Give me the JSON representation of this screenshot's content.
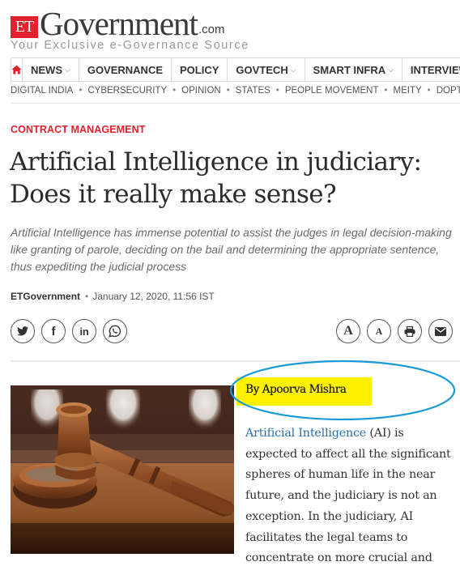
{
  "site": {
    "logo_badge": "ET",
    "logo_name": "Government",
    "logo_suffix": ".com",
    "tagline": "Your Exclusive e-Governance Source",
    "brand_color": "#e4202e"
  },
  "nav": {
    "home_icon": "home-icon",
    "items": [
      {
        "label": "NEWS",
        "has_dropdown": true
      },
      {
        "label": "GOVERNANCE",
        "has_dropdown": false
      },
      {
        "label": "POLICY",
        "has_dropdown": false
      },
      {
        "label": "GOVTECH",
        "has_dropdown": true
      },
      {
        "label": "SMART INFRA",
        "has_dropdown": true
      },
      {
        "label": "INTERVIEW",
        "has_dropdown": false
      }
    ],
    "dropdown_glyph": "⌵"
  },
  "subnav": {
    "items": [
      "DIGITAL INDIA",
      "CYBERSECURITY",
      "OPINION",
      "STATES",
      "PEOPLE MOVEMENT",
      "MEITY",
      "DOPT"
    ],
    "separator": "•"
  },
  "article": {
    "category": "CONTRACT MANAGEMENT",
    "headline": "Artificial Intelligence in judiciary: Does it really make sense?",
    "synopsis": "Artificial Intelligence has immense potential to assist the judges in legal decision-making like granting of parole, deciding on the bail and determining the appropriate sentence, thus expediting the judicial process",
    "source": "ETGovernment",
    "separator": "•",
    "date": "January 12, 2020, 11:56 IST",
    "image_alt": "Judge's gavel on a courtroom bench",
    "author": "By Apoorva Mishra",
    "highlight_color": "#fff200",
    "annotation_color": "#1a9ad6",
    "body_link": "Artificial Intelligence",
    "body_rest": " (AI) is expected to affect all the significant spheres of human life in the near future, and the judiciary is not an exception. In the judiciary, AI facilitates the legal teams to concentrate on more crucial and"
  },
  "share": {
    "left": [
      "twitter-icon",
      "facebook-icon",
      "linkedin-icon",
      "whatsapp-icon"
    ],
    "right": [
      "increase-font-icon",
      "decrease-font-icon",
      "print-icon",
      "email-icon"
    ],
    "facebook_glyph": "f",
    "linkedin_glyph": "in",
    "font_glyph": "A"
  }
}
